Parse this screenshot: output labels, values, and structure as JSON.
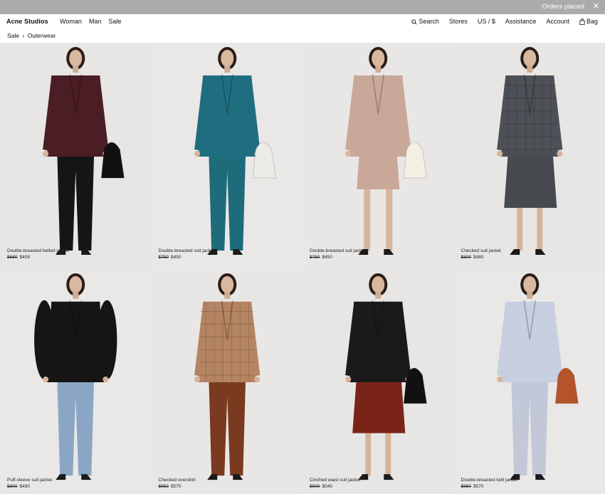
{
  "banner": {
    "text": "Orders placed",
    "close": "✕"
  },
  "nav": {
    "logo": "Acne Studios",
    "left": [
      "Woman",
      "Man",
      "Sale"
    ],
    "search": "Search",
    "stores": "Stores",
    "currency": "US / $",
    "assistance": "Assistance",
    "account": "Account",
    "bag": "Bag"
  },
  "breadcrumb": {
    "parent": "Sale",
    "separator": "›",
    "current": "Outerwear"
  },
  "products": [
    {
      "name": "Double-breasted belted jacket",
      "old_price": "$680",
      "price": "$408",
      "jacket": "#4a1e24",
      "bottom": "#151515",
      "bag": "#111111",
      "bg": "#e8e6e4"
    },
    {
      "name": "Double-breasted suit jacket",
      "old_price": "$750",
      "price": "$450",
      "jacket": "#1f6e80",
      "bottom": "#1e6b7b",
      "bag": "#ecebe6",
      "bg": "#e9e8e6"
    },
    {
      "name": "Double-breasted suit jacket",
      "old_price": "$750",
      "price": "$450",
      "jacket": "#c9a89a",
      "bottom": "#c9a89a",
      "bag": "#f3efe4",
      "bg": "#e9e7e5"
    },
    {
      "name": "Checked suit jacket",
      "old_price": "$800",
      "price": "$480",
      "jacket": "#4d5056",
      "bottom": "#46494e",
      "bag": "",
      "bg": "#e8e6e4"
    },
    {
      "name": "Puff-sleeve suit jacket",
      "old_price": "$800",
      "price": "$480",
      "jacket": "#151515",
      "bottom": "#8aa6c4",
      "bag": "",
      "bg": "#e9e8e6"
    },
    {
      "name": "Checked overshirt",
      "old_price": "$950",
      "price": "$570",
      "jacket": "#b58462",
      "bottom": "#7a3a1f",
      "bag": "",
      "bg": "#e9e7e5"
    },
    {
      "name": "Cinched waist suit jacket",
      "old_price": "$900",
      "price": "$540",
      "jacket": "#1a1a1a",
      "bottom": "#7a2418",
      "bag": "#111111",
      "bg": "#e8e6e4"
    },
    {
      "name": "Double-breasted twill jacket",
      "old_price": "$950",
      "price": "$570",
      "jacket": "#c7cfe0",
      "bottom": "#c2c8d8",
      "bag": "#b5532a",
      "bg": "#e9e8e6"
    }
  ]
}
